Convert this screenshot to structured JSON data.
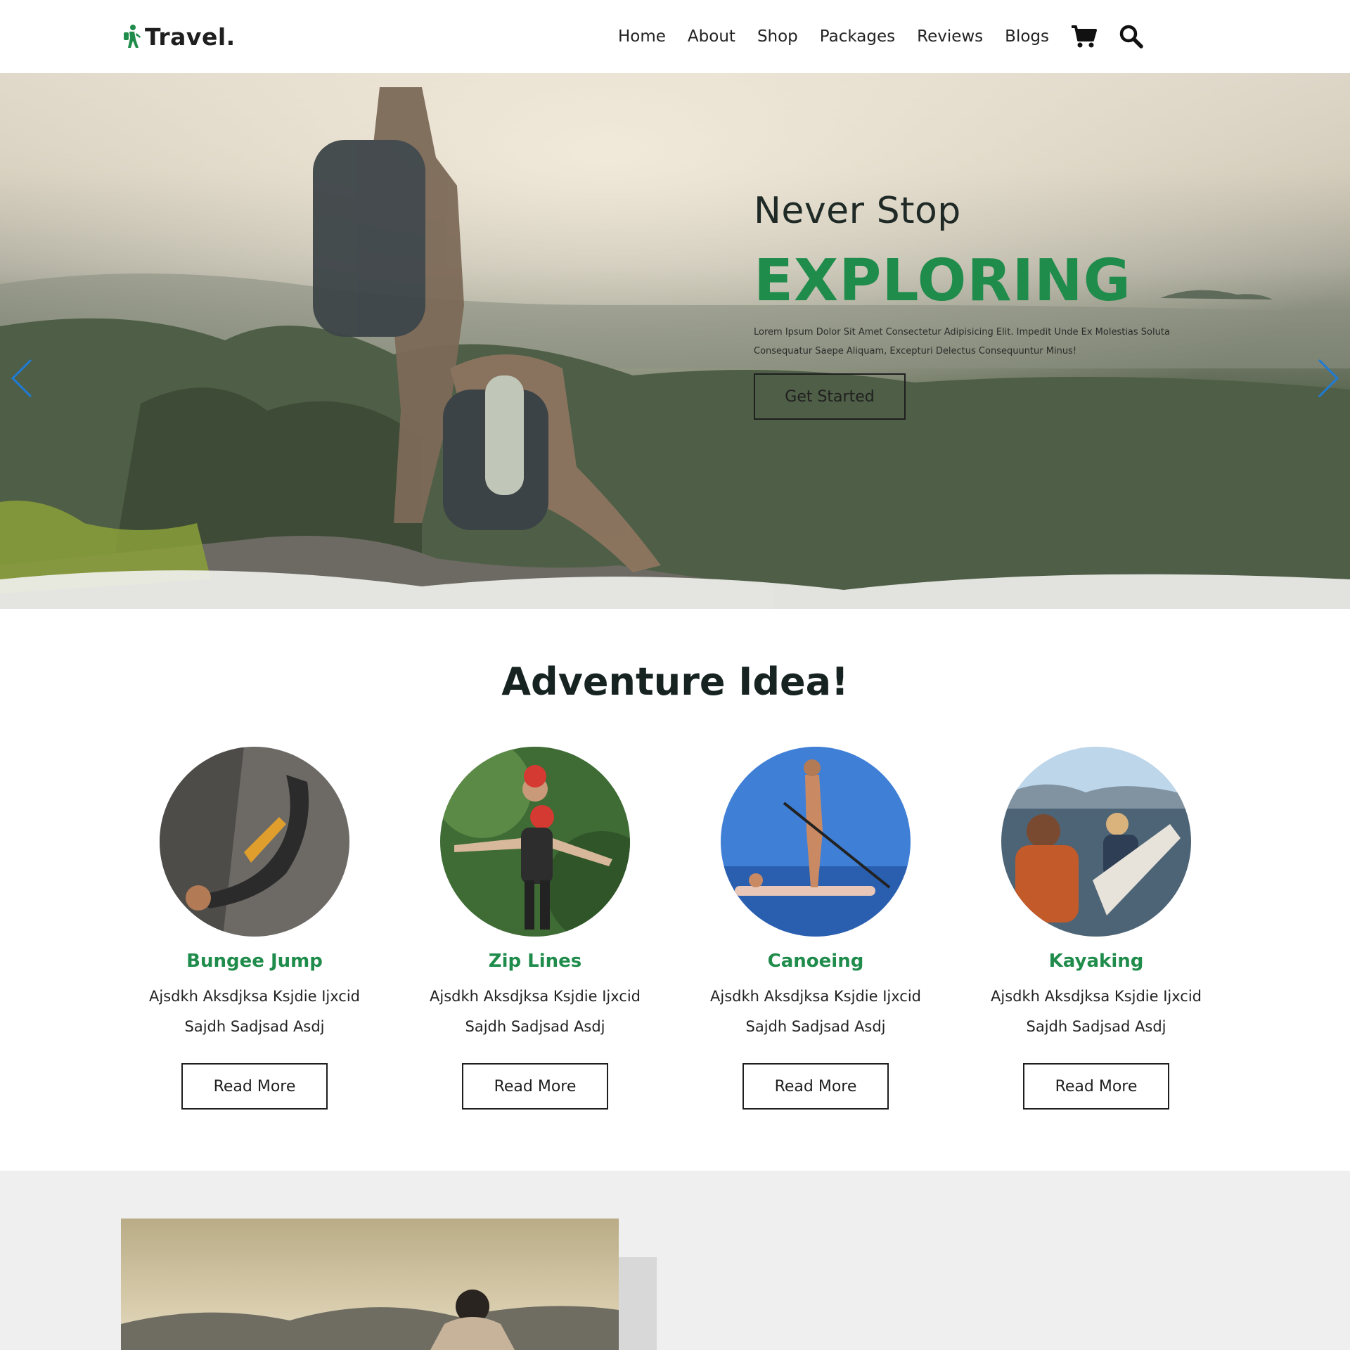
{
  "header": {
    "logo_text": "Travel.",
    "nav": [
      "Home",
      "About",
      "Shop",
      "Packages",
      "Reviews",
      "Blogs"
    ],
    "icons": [
      "cart-icon",
      "search-icon"
    ]
  },
  "hero": {
    "subtitle": "Never Stop",
    "title": "EXPLORING",
    "description": "Lorem Ipsum Dolor Sit Amet Consectetur Adipisicing Elit. Impedit Unde Ex Molestias Soluta Consequatur Saepe Aliquam, Excepturi Delectus Consequuntur Minus!",
    "button": "Get Started",
    "arrows": [
      "chevron-left-icon",
      "chevron-right-icon"
    ]
  },
  "adventure": {
    "title": "Adventure Idea!",
    "cards": [
      {
        "title": "Bungee Jump",
        "line1": "Ajsdkh Aksdjksa Ksjdie Ijxcid",
        "line2": "Sajdh Sadjsad Asdj",
        "button": "Read More"
      },
      {
        "title": "Zip Lines",
        "line1": "Ajsdkh Aksdjksa Ksjdie Ijxcid",
        "line2": "Sajdh Sadjsad Asdj",
        "button": "Read More"
      },
      {
        "title": "Canoeing",
        "line1": "Ajsdkh Aksdjksa Ksjdie Ijxcid",
        "line2": "Sajdh Sadjsad Asdj",
        "button": "Read More"
      },
      {
        "title": "Kayaking",
        "line1": "Ajsdkh Aksdjksa Ksjdie Ijxcid",
        "line2": "Sajdh Sadjsad Asdj",
        "button": "Read More"
      }
    ]
  },
  "colors": {
    "accent": "#1f8c4b",
    "text_dark": "#162320",
    "arrow": "#1e7bd6",
    "section_bg": "#efefef"
  }
}
